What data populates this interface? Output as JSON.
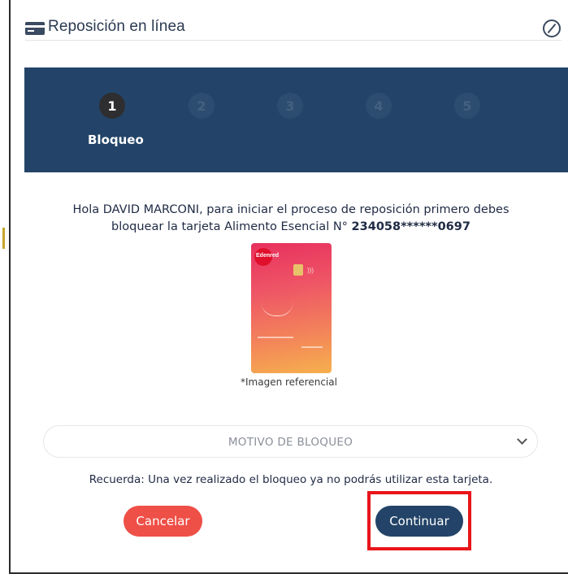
{
  "header": {
    "title": "Reposición en línea",
    "icon": "credit-card-icon"
  },
  "stepper": {
    "steps": [
      "1",
      "2",
      "3",
      "4",
      "5"
    ],
    "active_step": 1,
    "active_label": "Bloqueo"
  },
  "message": {
    "line1": "Hola DAVID MARCONI, para iniciar el proceso de reposición primero debes",
    "line2_prefix": "bloquear la tarjeta Alimento Esencial N° ",
    "card_number": "234058******0697"
  },
  "card": {
    "brand": "Edenred",
    "caption": "*Imagen referencial"
  },
  "select": {
    "value": "MOTIVO DE BLOQUEO"
  },
  "warning": "Recuerda: Una vez realizado el bloqueo ya no podrás utilizar esta tarjeta.",
  "buttons": {
    "cancel": "Cancelar",
    "continue": "Continuar"
  },
  "colors": {
    "primary": "#234468",
    "danger": "#ee4f46",
    "highlight": "#e8151a"
  }
}
